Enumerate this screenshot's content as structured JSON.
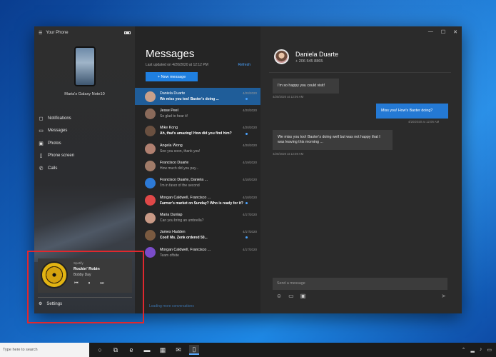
{
  "app": {
    "title": "Your Phone",
    "device_name": "Maria's Galaxy Note10"
  },
  "nav": {
    "items": [
      {
        "label": "Notifications",
        "icon": "bell-icon"
      },
      {
        "label": "Messages",
        "icon": "chat-icon"
      },
      {
        "label": "Photos",
        "icon": "photo-icon"
      },
      {
        "label": "Phone screen",
        "icon": "phone-screen-icon"
      },
      {
        "label": "Calls",
        "icon": "calls-icon"
      }
    ],
    "settings_label": "Settings"
  },
  "music": {
    "app": "Spotify",
    "title": "Rockin' Robin",
    "artist": "Bobby Day"
  },
  "messages_pane": {
    "title": "Messages",
    "updated": "Last updated on 4/20/2020 at 12:12 PM",
    "refresh_label": "Refresh",
    "new_message_label": "+ New message",
    "see_all_label": "Loading more conversations",
    "conversations": [
      {
        "name": "Daniela Duarte",
        "date": "4/20/2020",
        "preview": "We miss you too! Baxter's doing ...",
        "active": true,
        "bold": true,
        "unread": true,
        "color": "#c9a08a"
      },
      {
        "name": "Jesse Peel",
        "date": "4/20/2020",
        "preview": "So glad to hear it!",
        "active": false,
        "bold": false,
        "unread": false,
        "color": "#8a6a5a"
      },
      {
        "name": "Mike Kong",
        "date": "4/20/2020",
        "preview": "Ah, that's amazing! How did you find him?",
        "active": false,
        "bold": true,
        "unread": true,
        "color": "#6a5040"
      },
      {
        "name": "Angela Wong",
        "date": "4/20/2020",
        "preview": "See you soon, thank you!",
        "active": false,
        "bold": false,
        "unread": false,
        "color": "#b08070"
      },
      {
        "name": "Francisco Duarte",
        "date": "4/19/2020",
        "preview": "How much did you pay...",
        "active": false,
        "bold": false,
        "unread": false,
        "color": "#a07b68"
      },
      {
        "name": "Francisco Duarte, Daniela ...",
        "date": "4/18/2020",
        "preview": "I'm in favor of the second",
        "active": false,
        "bold": false,
        "unread": false,
        "color": "#2d7ad6"
      },
      {
        "name": "Morgan Caldwell, Francisco ...",
        "date": "4/18/2020",
        "preview": "Farmer's market on Sunday? Who is ready for it?",
        "active": false,
        "bold": true,
        "unread": true,
        "color": "#e04848"
      },
      {
        "name": "Maria Dunlap",
        "date": "4/17/2020",
        "preview": "Can you bring an umbrella?",
        "active": false,
        "bold": false,
        "unread": false,
        "color": "#c99a86"
      },
      {
        "name": "James Hadden",
        "date": "4/17/2020",
        "preview": "Cool! Ms. Zenk ordered 50...",
        "active": false,
        "bold": true,
        "unread": true,
        "color": "#7a5a40"
      },
      {
        "name": "Morgan Caldwell, Francisco ...",
        "date": "4/17/2020",
        "preview": "Team offsite",
        "active": false,
        "bold": false,
        "unread": false,
        "color": "#7a4cc9"
      }
    ]
  },
  "chat": {
    "contact_name": "Daniela Duarte",
    "contact_phone": "+ 206 545 8865",
    "messages": [
      {
        "text": "I'm so happy you could visit!",
        "time": "4/20/2020 at 12:05 AM",
        "dir": "in"
      },
      {
        "text": "Miss you! How's Baxter doing?",
        "time": "4/20/2020 at 12:06 AM",
        "dir": "out"
      },
      {
        "text": "We miss you too! Baxter's doing well but was not happy that I was leaving this morning ...",
        "time": "4/20/2020 at 12:08 AM",
        "dir": "in"
      }
    ],
    "composer_placeholder": "Send a message"
  },
  "taskbar": {
    "search_placeholder": "Type here to search"
  }
}
